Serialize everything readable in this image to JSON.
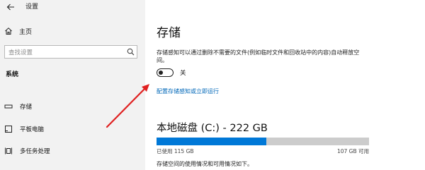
{
  "window": {
    "title": "设置"
  },
  "sidebar": {
    "home_label": "主页",
    "search": {
      "placeholder": "查找设置"
    },
    "section_title": "系统",
    "items": [
      {
        "label": "存储",
        "icon": "storage-drive-icon"
      },
      {
        "label": "平板电脑",
        "icon": "tablet-icon"
      },
      {
        "label": "多任务处理",
        "icon": "multitasking-icon"
      }
    ]
  },
  "main": {
    "title": "存储",
    "description": "存储感知可以通过删除不需要的文件(例如临时文件和回收站中的内容)自动释放空间。",
    "storage_sense": {
      "state_label": "关",
      "on": false
    },
    "config_link": "配置存储感知或立即运行",
    "drive": {
      "title": "本地磁盘 (C:) - 222 GB",
      "used_label": "已使用 115 GB",
      "available_label": "107 GB 可用",
      "used_fraction": 0.518
    },
    "usage_description": "存储空间的使用情况和可用情况如下。"
  },
  "colors": {
    "accent": "#0078d7",
    "link": "#0067b8",
    "sidebar_bg": "#f2f2f2",
    "annotation_arrow": "#e02020"
  }
}
